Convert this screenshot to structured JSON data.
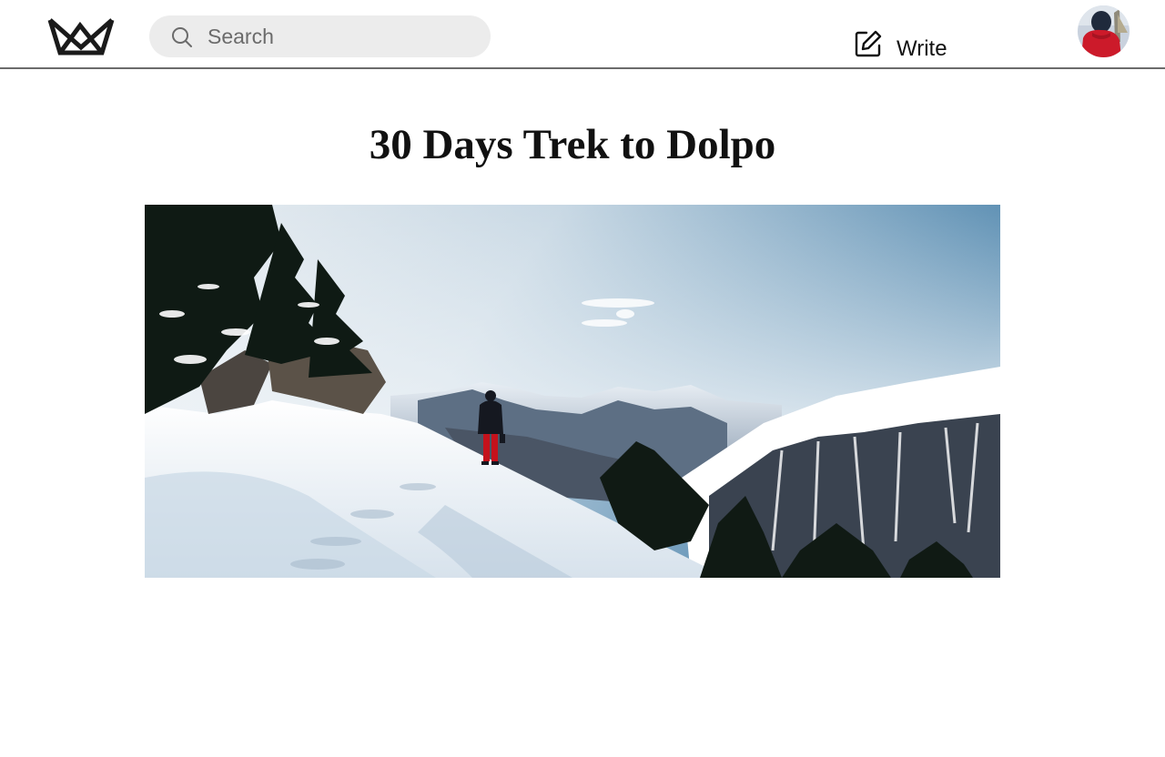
{
  "header": {
    "logo_icon": "crown-logo-icon",
    "search": {
      "placeholder": "Search",
      "value": "",
      "icon": "search-icon"
    },
    "write": {
      "label": "Write",
      "icon": "pencil-square-icon"
    },
    "avatar": {
      "icon": "user-avatar"
    }
  },
  "article": {
    "title": "30 Days Trek to Dolpo",
    "hero_image": "snowy-mountain-hiker-photo"
  },
  "colors": {
    "text": "#111111",
    "search_bg": "#ececec",
    "divider": "#6b6b6b",
    "placeholder": "#6b6b6b"
  }
}
